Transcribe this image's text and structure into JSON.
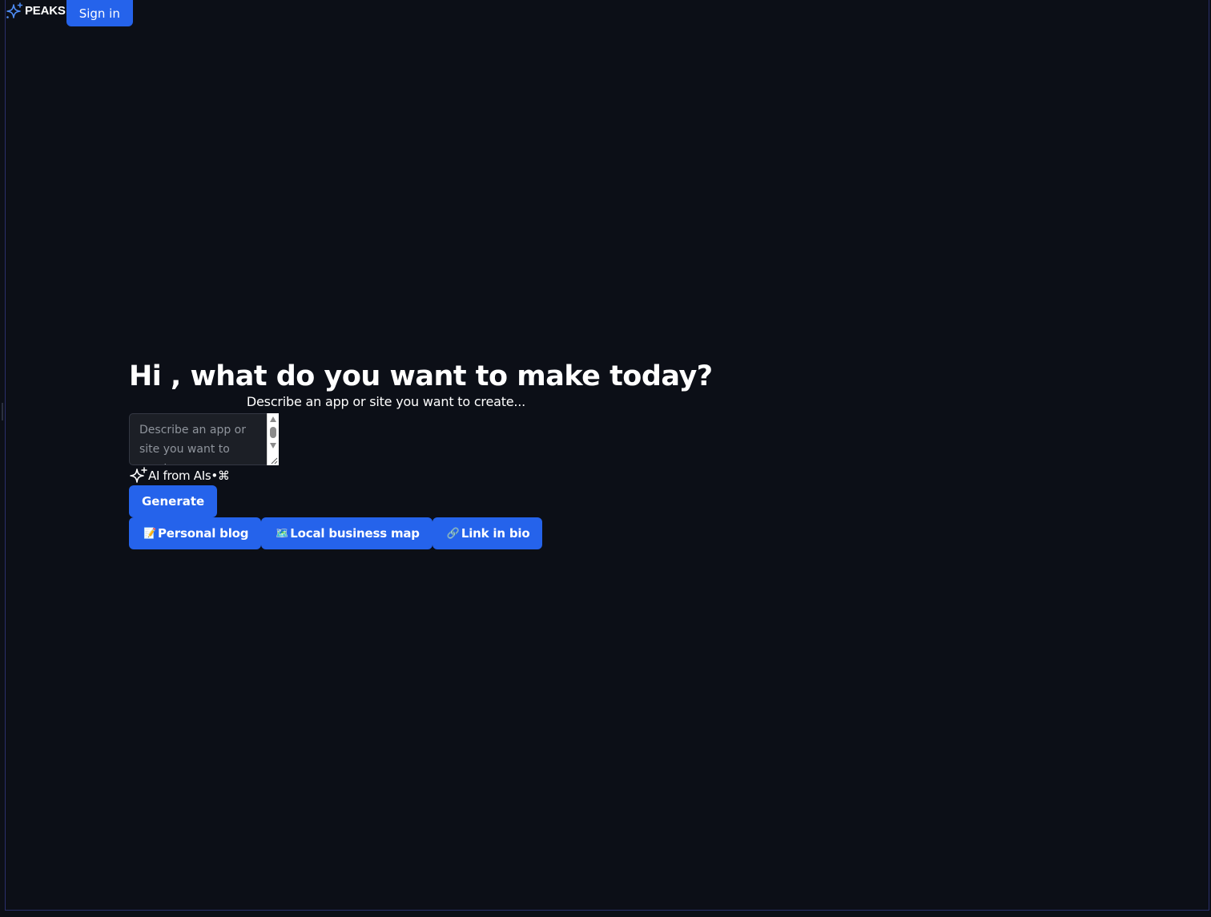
{
  "header": {
    "brand": "PEAKS",
    "logo_icon": "sparkle-icon",
    "signin_label": "Sign in"
  },
  "main": {
    "title": "Hi , what do you want to make today?",
    "subtitle": "Describe an app or site you want to create...",
    "prompt": {
      "value": "",
      "placeholder": "Describe an app or site you want to create..."
    },
    "ai_hint": {
      "icon": "sparkle-icon",
      "label": "AI from AIs",
      "separator": "•",
      "shortcut": "⌘"
    },
    "generate_label": "Generate",
    "suggestions": [
      {
        "emoji": "📝",
        "label": "Personal blog"
      },
      {
        "emoji": "🗺️",
        "label": "Local business map"
      },
      {
        "emoji": "🔗",
        "label": "Link in bio"
      }
    ]
  },
  "colors": {
    "background": "#0c0f17",
    "accent": "#2563eb",
    "frame_border": "#2a2f6b",
    "logo": "#4f8df7"
  }
}
